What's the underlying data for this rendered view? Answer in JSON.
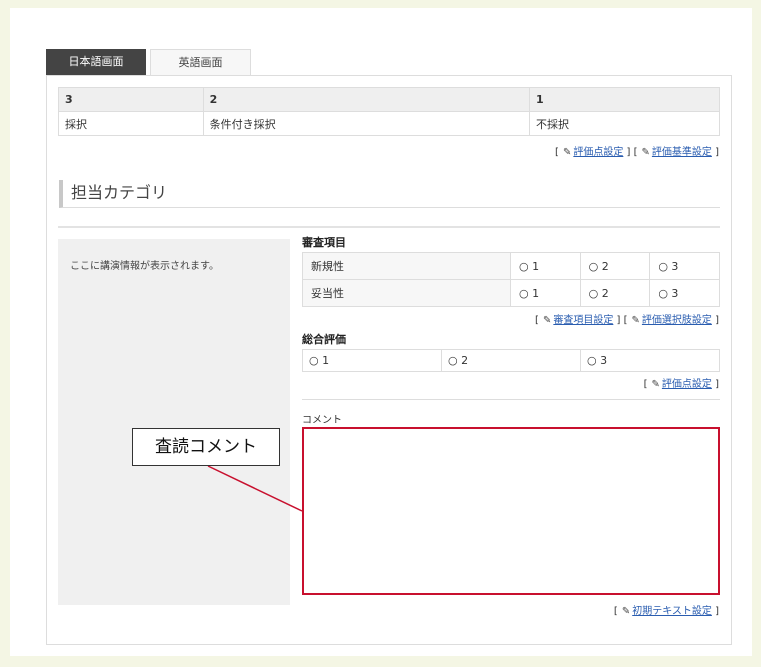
{
  "tabs": [
    {
      "label": "日本語画面",
      "active": true
    },
    {
      "label": "英語画面",
      "active": false
    }
  ],
  "score_table": {
    "headers": [
      "3",
      "2",
      "1"
    ],
    "values": [
      "採択",
      "条件付き採択",
      "不採択"
    ]
  },
  "links_top": {
    "eval_points": "評価点設定",
    "eval_criteria": "評価基準設定"
  },
  "category": {
    "title": "担当カテゴリ"
  },
  "lecture": {
    "placeholder": "ここに講演情報が表示されます。"
  },
  "review": {
    "title": "審査項目",
    "items": [
      {
        "name": "新規性",
        "options": [
          "1",
          "2",
          "3"
        ]
      },
      {
        "name": "妥当性",
        "options": [
          "1",
          "2",
          "3"
        ]
      }
    ],
    "links": {
      "review_items": "審査項目設定",
      "eval_options": "評価選択肢設定"
    }
  },
  "overall": {
    "title": "総合評価",
    "options": [
      "1",
      "2",
      "3"
    ],
    "link": "評価点設定"
  },
  "comment": {
    "label": "コメント",
    "link": "初期テキスト設定"
  },
  "callout": {
    "text": "査読コメント"
  },
  "colors": {
    "accent": "#c8102e",
    "tab_active": "#444444",
    "link": "#2a5db0"
  }
}
